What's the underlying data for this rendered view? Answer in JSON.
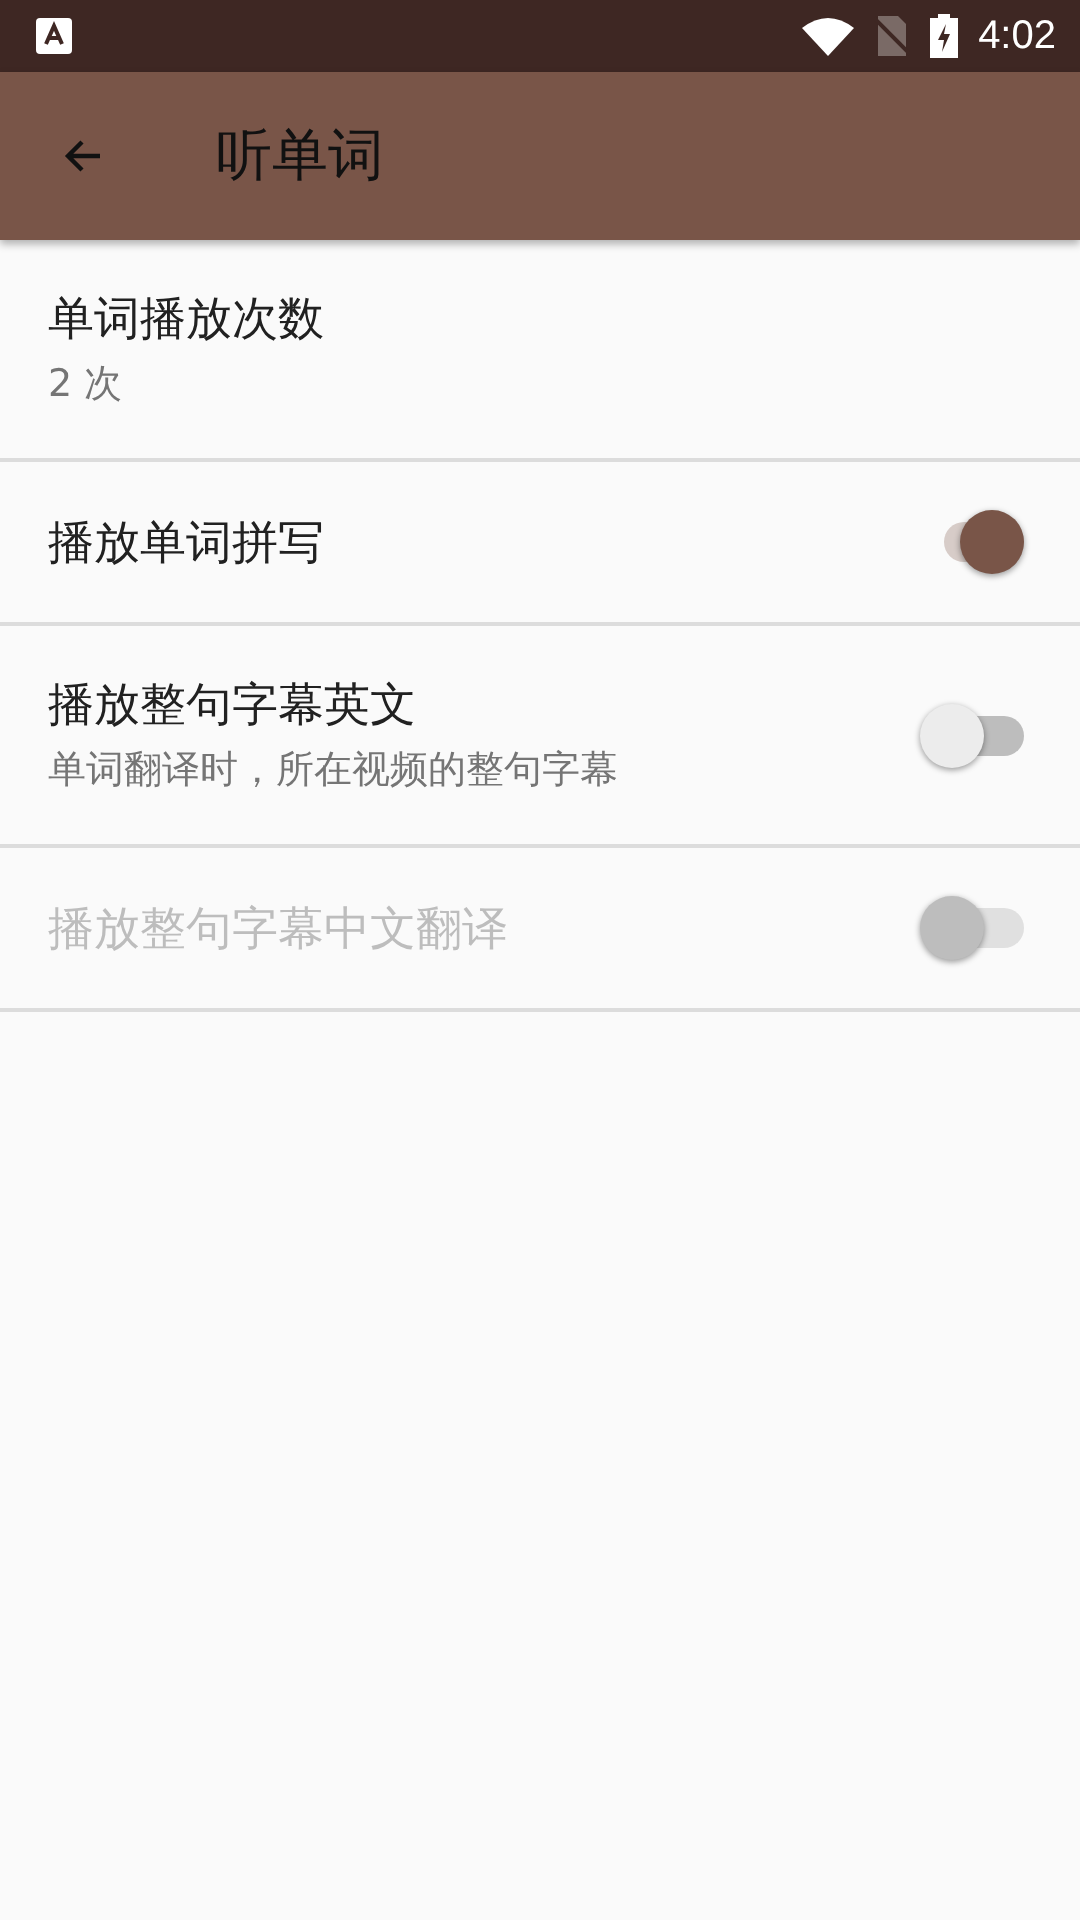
{
  "status_bar": {
    "time": "4:02"
  },
  "toolbar": {
    "title": "听单词"
  },
  "settings": [
    {
      "kind": "value",
      "title": "单词播放次数",
      "summary": "2 次"
    },
    {
      "kind": "switch",
      "title": "播放单词拼写",
      "on": true,
      "disabled": false
    },
    {
      "kind": "switch",
      "title": "播放整句字幕英文",
      "summary": "单词翻译时，所在视频的整句字幕",
      "on": false,
      "disabled": false
    },
    {
      "kind": "switch",
      "title": "播放整句字幕中文翻译",
      "on": false,
      "disabled": true
    }
  ]
}
